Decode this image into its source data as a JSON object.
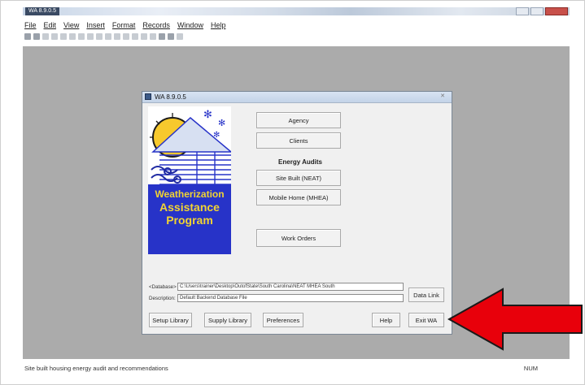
{
  "app": {
    "title": "WA 8.9.0.5",
    "menu": [
      "File",
      "Edit",
      "View",
      "Insert",
      "Format",
      "Records",
      "Window",
      "Help"
    ]
  },
  "status": {
    "left": "Site built housing energy audit and recommendations",
    "right": "NUM"
  },
  "dialog": {
    "title": "WA 8.9.0.5",
    "logo_lines": [
      "Weatherization",
      "Assistance",
      "Program"
    ],
    "buttons": {
      "agency": "Agency",
      "clients": "Clients",
      "site_built": "Site Built (NEAT)",
      "mobile_home": "Mobile Home (MHEA)",
      "work_orders": "Work Orders",
      "data_link": "Data Link",
      "setup_library": "Setup Library",
      "supply_library": "Supply Library",
      "preferences": "Preferences",
      "help": "Help",
      "exit": "Exit WA"
    },
    "energy_audits_label": "Energy Audits",
    "database_label": "<Database>",
    "database_value": "C:\\Users\\trainer\\Desktop\\OutofState\\South Carolina\\NEAT MHEA South",
    "description_label": "Description:",
    "description_value": "Default Backend Database File"
  },
  "colors": {
    "workspace": "#ababab",
    "callout_arrow": "#e8000b",
    "logo_blue": "#2733c8",
    "logo_yellow": "#f2d432",
    "sun": "#f7c92d"
  }
}
